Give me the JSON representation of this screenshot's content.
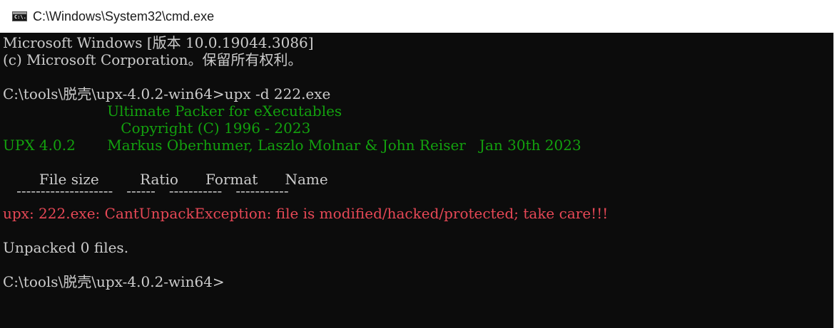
{
  "window": {
    "title": "C:\\Windows\\System32\\cmd.exe",
    "icon": "cmd-console-icon",
    "icon_text": "C:\\."
  },
  "colors": {
    "background": "#0c0c0c",
    "text": "#cccccc",
    "green": "#13a10e",
    "red": "#e74856"
  },
  "console": {
    "lines": [
      "Microsoft Windows [版本 10.0.19044.3086]",
      "(c) Microsoft Corporation。保留所有权利。",
      "",
      "C:\\tools\\脱壳\\upx-4.0.2-win64>upx -d 222.exe",
      "                       Ultimate Packer for eXecutables",
      "                          Copyright (C) 1996 - 2023",
      "UPX 4.0.2       Markus Oberhumer, Laszlo Molnar & John Reiser   Jan 30th 2023",
      "",
      "        File size         Ratio      Format      Name",
      "   --------------------   ------   -----------   -----------",
      "upx: 222.exe: CantUnpackException: file is modified/hacked/protected; take care!!!",
      "",
      "Unpacked 0 files.",
      "",
      "C:\\tools\\脱壳\\upx-4.0.2-win64>"
    ]
  }
}
